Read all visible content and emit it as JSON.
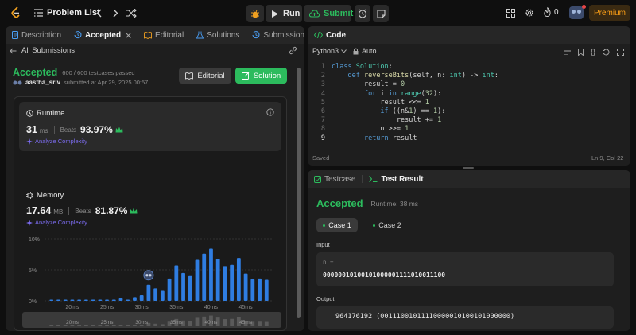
{
  "topbar": {
    "title": "Problem List",
    "run_label": "Run",
    "submit_label": "Submit",
    "streak_count": "0",
    "premium_label": "Premium"
  },
  "left": {
    "tabs": [
      {
        "label": "Description"
      },
      {
        "label": "Accepted"
      },
      {
        "label": "Editorial"
      },
      {
        "label": "Solutions"
      },
      {
        "label": "Submissions"
      }
    ],
    "back_label": "All Submissions",
    "status": "Accepted",
    "testcases": "600 / 600 testcases passed",
    "user": "aastha_sriv",
    "submitted_at": "submitted at Apr 29, 2025 00:57",
    "editorial_btn": "Editorial",
    "solution_btn": "Solution",
    "runtime": {
      "title": "Runtime",
      "value": "31",
      "unit": "ms",
      "beats_label": "Beats",
      "beats_value": "93.97%",
      "analyze": "Analyze Complexity"
    },
    "memory": {
      "title": "Memory",
      "value": "17.64",
      "unit": "MB",
      "beats_label": "Beats",
      "beats_value": "81.87%",
      "analyze": "Analyze Complexity"
    }
  },
  "chart_data": {
    "type": "bar",
    "ylim": [
      0,
      10
    ],
    "y_ticks": [
      "10%",
      "5%",
      "0%"
    ],
    "x_tick_labels": [
      "20ms",
      "25ms",
      "30ms",
      "35ms",
      "40ms",
      "45ms"
    ],
    "x_tick_ms": [
      20,
      25,
      30,
      35,
      40,
      45
    ],
    "xlim": [
      16,
      49
    ],
    "x": [
      17,
      18,
      19,
      20,
      21,
      22,
      23,
      24,
      25,
      26,
      27,
      28,
      29,
      30,
      31,
      32,
      33,
      34,
      35,
      36,
      37,
      38,
      39,
      40,
      41,
      42,
      43,
      44,
      45,
      46,
      47,
      48
    ],
    "values": [
      0.2,
      0.2,
      0.2,
      0.2,
      0.2,
      0.2,
      0.2,
      0.2,
      0.2,
      0.2,
      0.4,
      0.2,
      0.6,
      0.9,
      2.6,
      2.0,
      1.6,
      3.6,
      5.7,
      4.5,
      4.0,
      6.6,
      7.6,
      8.4,
      6.8,
      5.6,
      5.8,
      6.9,
      4.4,
      3.5,
      3.6,
      3.4
    ],
    "highlight_x": 31,
    "bar_color": "#2f7de1"
  },
  "code": {
    "title": "Code",
    "language": "Python3",
    "mode": "Auto",
    "lines": [
      "class Solution:",
      "    def reverseBits(self, n: int) -> int:",
      "        result = 0",
      "        for i in range(32):",
      "            result <<= 1",
      "            if ((n&1) == 1):",
      "                result += 1",
      "            n >>= 1",
      "        return result"
    ],
    "saved": "Saved",
    "cursor": "Ln 9, Col 22"
  },
  "test": {
    "testcase_tab": "Testcase",
    "result_tab": "Test Result",
    "status": "Accepted",
    "runtime": "Runtime: 38 ms",
    "cases": [
      {
        "label": "Case 1"
      },
      {
        "label": "Case 2"
      }
    ],
    "input_label": "Input",
    "input_var": "n =",
    "input_value": "00000010100101000001111010011100",
    "output_label": "Output",
    "output_value": "964176192 (00111001011110000010100101000000)"
  },
  "colors": {
    "accent_green": "#2cbb5d",
    "accent_blue": "#2f7de1",
    "premium": "#ffa116"
  }
}
